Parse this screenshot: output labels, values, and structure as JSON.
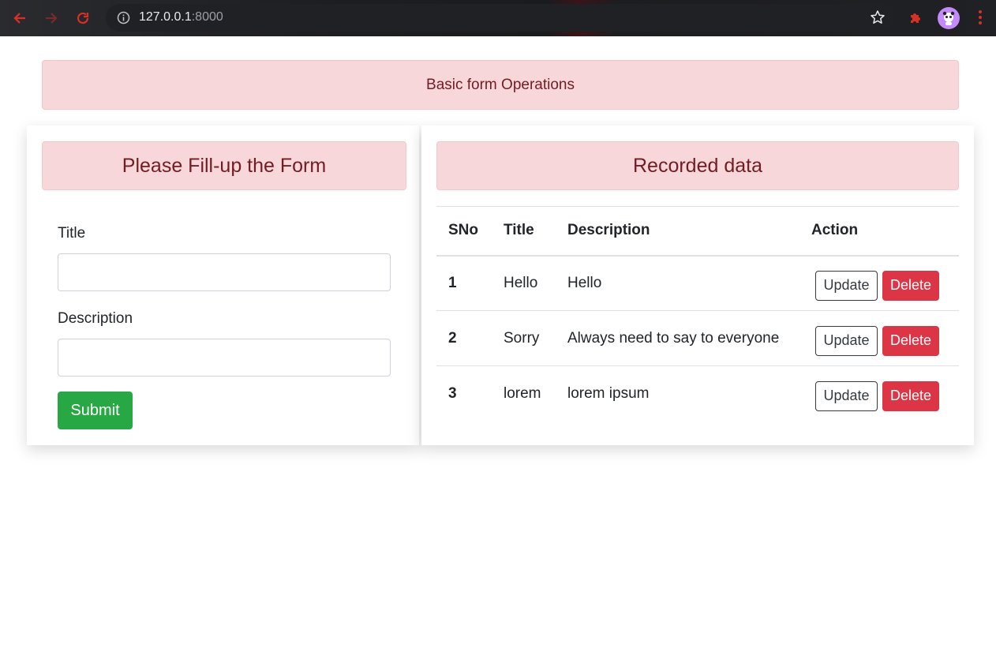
{
  "browser": {
    "url_host": "127.0.0.1",
    "url_port": ":8000",
    "icons": [
      "back-arrow-icon",
      "forward-arrow-icon",
      "reload-icon",
      "info-icon",
      "star-icon",
      "puzzle-extension-icon",
      "profile-avatar-icon",
      "menu-kebab-icon"
    ]
  },
  "page": {
    "banner": "Basic form Operations"
  },
  "form": {
    "header": "Please Fill-up the Form",
    "title_label": "Title",
    "title_value": "",
    "description_label": "Description",
    "description_value": "",
    "submit_label": "Submit"
  },
  "records": {
    "header": "Recorded data",
    "columns": [
      "SNo",
      "Title",
      "Description",
      "Action"
    ],
    "rows": [
      {
        "sno": "1",
        "title": "Hello",
        "description": "Hello"
      },
      {
        "sno": "2",
        "title": "Sorry",
        "description": "Always need to say to everyone"
      },
      {
        "sno": "3",
        "title": "lorem",
        "description": "lorem ipsum"
      }
    ],
    "update_label": "Update",
    "delete_label": "Delete"
  },
  "colors": {
    "alert_bg": "#f8d7da",
    "alert_text": "#721c24",
    "success": "#28a745",
    "danger": "#dc3545",
    "chrome_accent": "#d93025"
  }
}
